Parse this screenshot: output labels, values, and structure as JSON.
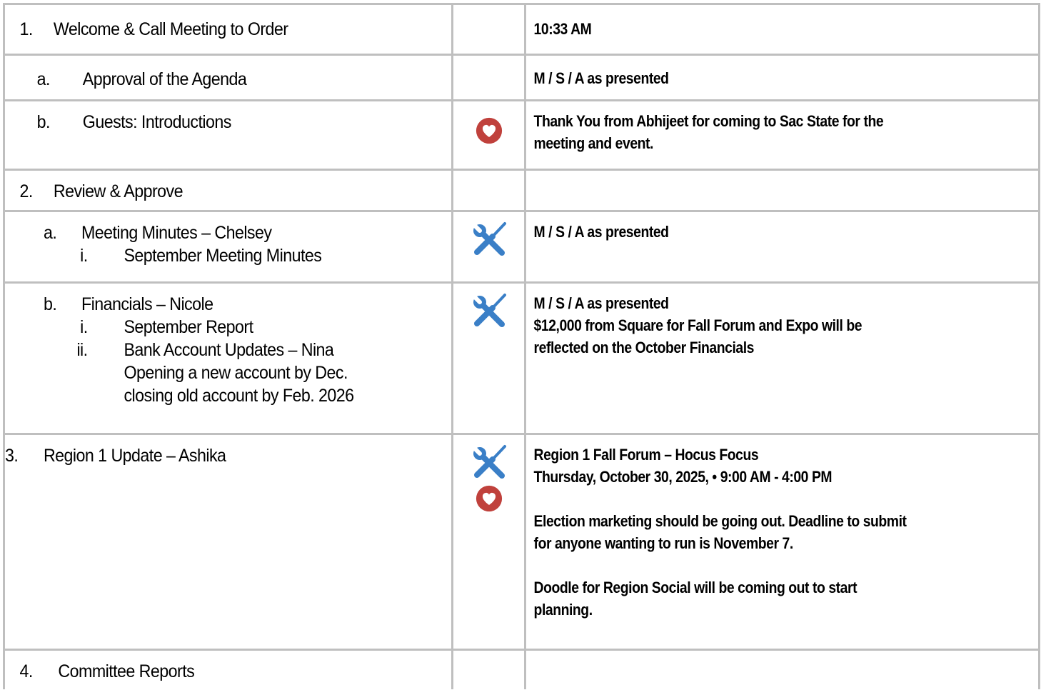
{
  "agenda": {
    "r1": {
      "num": "1.",
      "label": "Welcome & Call Meeting to Order",
      "note": "10:33 AM"
    },
    "r2": {
      "num": "a.",
      "label": "Approval of the Agenda",
      "note": "M / S / A as presented"
    },
    "r3": {
      "num": "b.",
      "label": "Guests: Introductions",
      "icons": [
        "heart-icon"
      ],
      "note_lines": [
        "Thank You from Abhijeet for coming to Sac State for the",
        "meeting and event."
      ]
    },
    "r4": {
      "num": "2.",
      "label": "Review & Approve"
    },
    "r5": {
      "num": "a.",
      "label": "Meeting Minutes – Chelsey",
      "sub": [
        {
          "num": "i.",
          "label": "September Meeting Minutes"
        }
      ],
      "icons": [
        "tools-icon"
      ],
      "note": "M / S / A as presented"
    },
    "r6": {
      "num": "b.",
      "label": "Financials – Nicole",
      "sub": [
        {
          "num": "i.",
          "label": "September Report"
        },
        {
          "num": "ii.",
          "label": "Bank Account Updates – Nina"
        }
      ],
      "extra_lines": [
        "Opening a new account by Dec.",
        "closing old account by Feb. 2026"
      ],
      "icons": [
        "tools-icon"
      ],
      "note_lines": [
        "M / S / A as presented",
        "$12,000 from Square for Fall Forum and Expo will be",
        "reflected on the October Financials"
      ]
    },
    "r7": {
      "num": "3.",
      "label": "Region 1 Update – Ashika",
      "icons": [
        "tools-icon",
        "heart-icon"
      ],
      "note_lines": [
        "Region 1 Fall Forum – Hocus Focus",
        "Thursday, October 30, 2025, • 9:00 AM - 4:00 PM",
        "",
        "Election marketing should be going out. Deadline to submit",
        "for anyone wanting to run is November 7.",
        "",
        "Doodle for Region Social will be coming out to start",
        "planning."
      ]
    },
    "r8": {
      "num": "4.",
      "label": "Committee Reports"
    }
  },
  "colors": {
    "border": "#bfbfbf",
    "tools_icon": "#3a7fc7",
    "heart_icon": "#c0413c"
  }
}
